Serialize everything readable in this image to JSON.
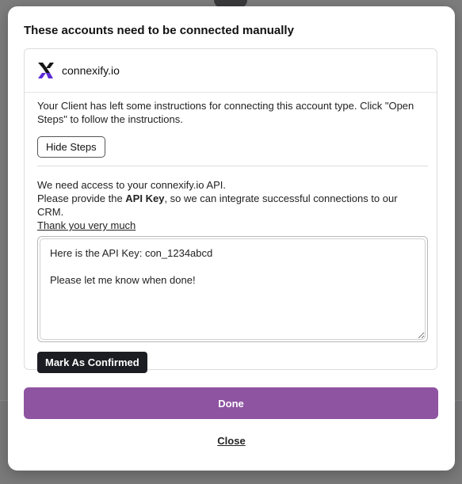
{
  "modal": {
    "title": "These accounts need to be connected manually",
    "brand": {
      "logo_icon": "connexify-logo",
      "name": "connexify.io",
      "accent": "#5b2bd6"
    },
    "instructions": "Your Client has left some instructions for connecting this account type. Click \"Open Steps\" to follow the instructions.",
    "hide_steps_label": "Hide Steps",
    "request": {
      "line1": "We need access to your connexify.io API.",
      "line2_prefix": "Please provide the ",
      "line2_bold": "API Key",
      "line2_suffix": ", so we can integrate successful connections to our CRM.",
      "thanks_link": "Thank you very much"
    },
    "reply_value": "Here is the API Key: con_1234abcd\n\nPlease let me know when done!",
    "confirm_label": "Mark As Confirmed",
    "done_label": "Done",
    "close_label": "Close"
  },
  "colors": {
    "done_button": "#8e54a2",
    "confirm_button": "#1c1d22"
  }
}
